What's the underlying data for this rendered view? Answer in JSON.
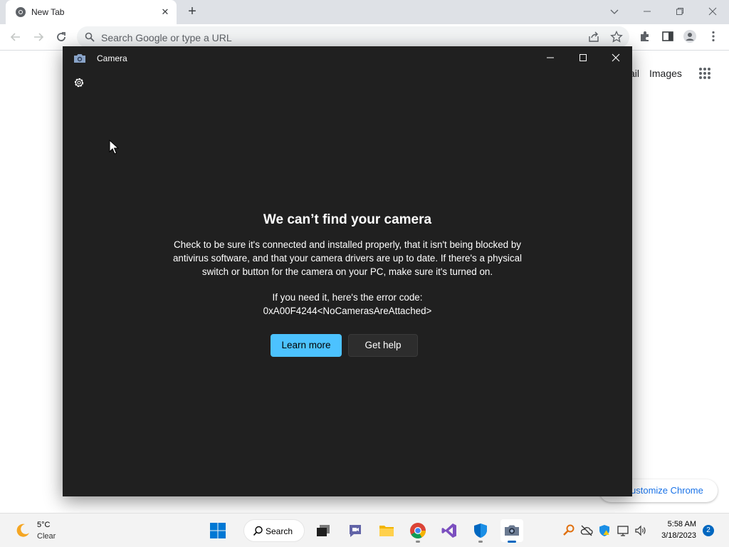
{
  "browser": {
    "tab_title": "New Tab",
    "omnibox_placeholder": "Search Google or type a URL",
    "page_links": {
      "gmail_partial": "ail",
      "images": "Images"
    },
    "customize_partial": "ustomize Chrome"
  },
  "camera_app": {
    "title": "Camera",
    "error_title": "We can’t find your camera",
    "error_body": "Check to be sure it's connected and installed properly, that it isn't being blocked by antivirus software, and that your camera drivers are up to date. If there's a physical switch or button for the camera on your PC, make sure it's turned on.",
    "error_code_label": "If you need it, here's the error code:",
    "error_code": "0xA00F4244<NoCamerasAreAttached>",
    "learn_more_label": "Learn more",
    "get_help_label": "Get help",
    "accent_color": "#4cc2ff"
  },
  "taskbar": {
    "weather_temp": "5°C",
    "weather_condition": "Clear",
    "search_label": "Search",
    "clock_time": "5:58 AM",
    "clock_date": "3/18/2023",
    "notification_count": "2",
    "apps": [
      "start-icon",
      "search",
      "task-view-icon",
      "chat-icon",
      "file-explorer-icon",
      "chrome-icon",
      "visual-studio-icon",
      "defender-icon",
      "camera-icon"
    ]
  }
}
